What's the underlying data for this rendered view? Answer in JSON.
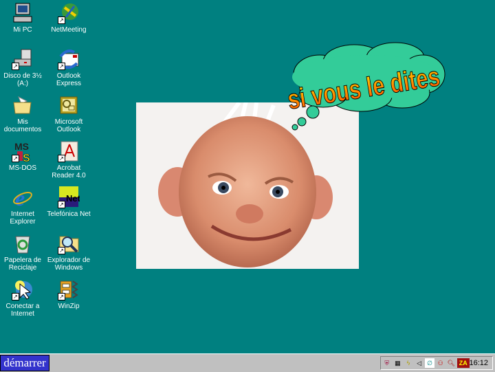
{
  "desktop": {
    "icons": [
      {
        "label": "Mi PC",
        "icon": "computer-icon"
      },
      {
        "label": "NetMeeting",
        "icon": "netmeeting-icon"
      },
      {
        "label": "Disco de 3½\n(A:)",
        "icon": "floppy-drive-icon"
      },
      {
        "label": "Outlook\nExpress",
        "icon": "outlook-express-icon"
      },
      {
        "label": "Mis\ndocumentos",
        "icon": "folder-icon"
      },
      {
        "label": "Microsoft\nOutlook",
        "icon": "outlook-icon"
      },
      {
        "label": "MS-DOS",
        "icon": "ms-dos-icon"
      },
      {
        "label": "Acrobat\nReader 4.0",
        "icon": "acrobat-icon"
      },
      {
        "label": "Internet\nExplorer",
        "icon": "internet-explorer-icon"
      },
      {
        "label": "Telefónica Net",
        "icon": "telefonica-net-icon"
      },
      {
        "label": "Papelera de\nReciclaje",
        "icon": "recycle-bin-icon"
      },
      {
        "label": "Explorador de\nWindows",
        "icon": "windows-explorer-icon"
      },
      {
        "label": "Conectar a\nInternet",
        "icon": "connect-internet-icon"
      },
      {
        "label": "WinZip",
        "icon": "winzip-icon"
      }
    ],
    "bubble_text": "si vous le dites",
    "net_icon_text": "Net",
    "msdos_icon_text": "MS"
  },
  "taskbar": {
    "start_label": "démarrer",
    "clock": "16:12",
    "tray_za": "ZA"
  },
  "colors": {
    "desktop": "#008080",
    "start": "#3333cc",
    "bubble": "#33cc99"
  }
}
